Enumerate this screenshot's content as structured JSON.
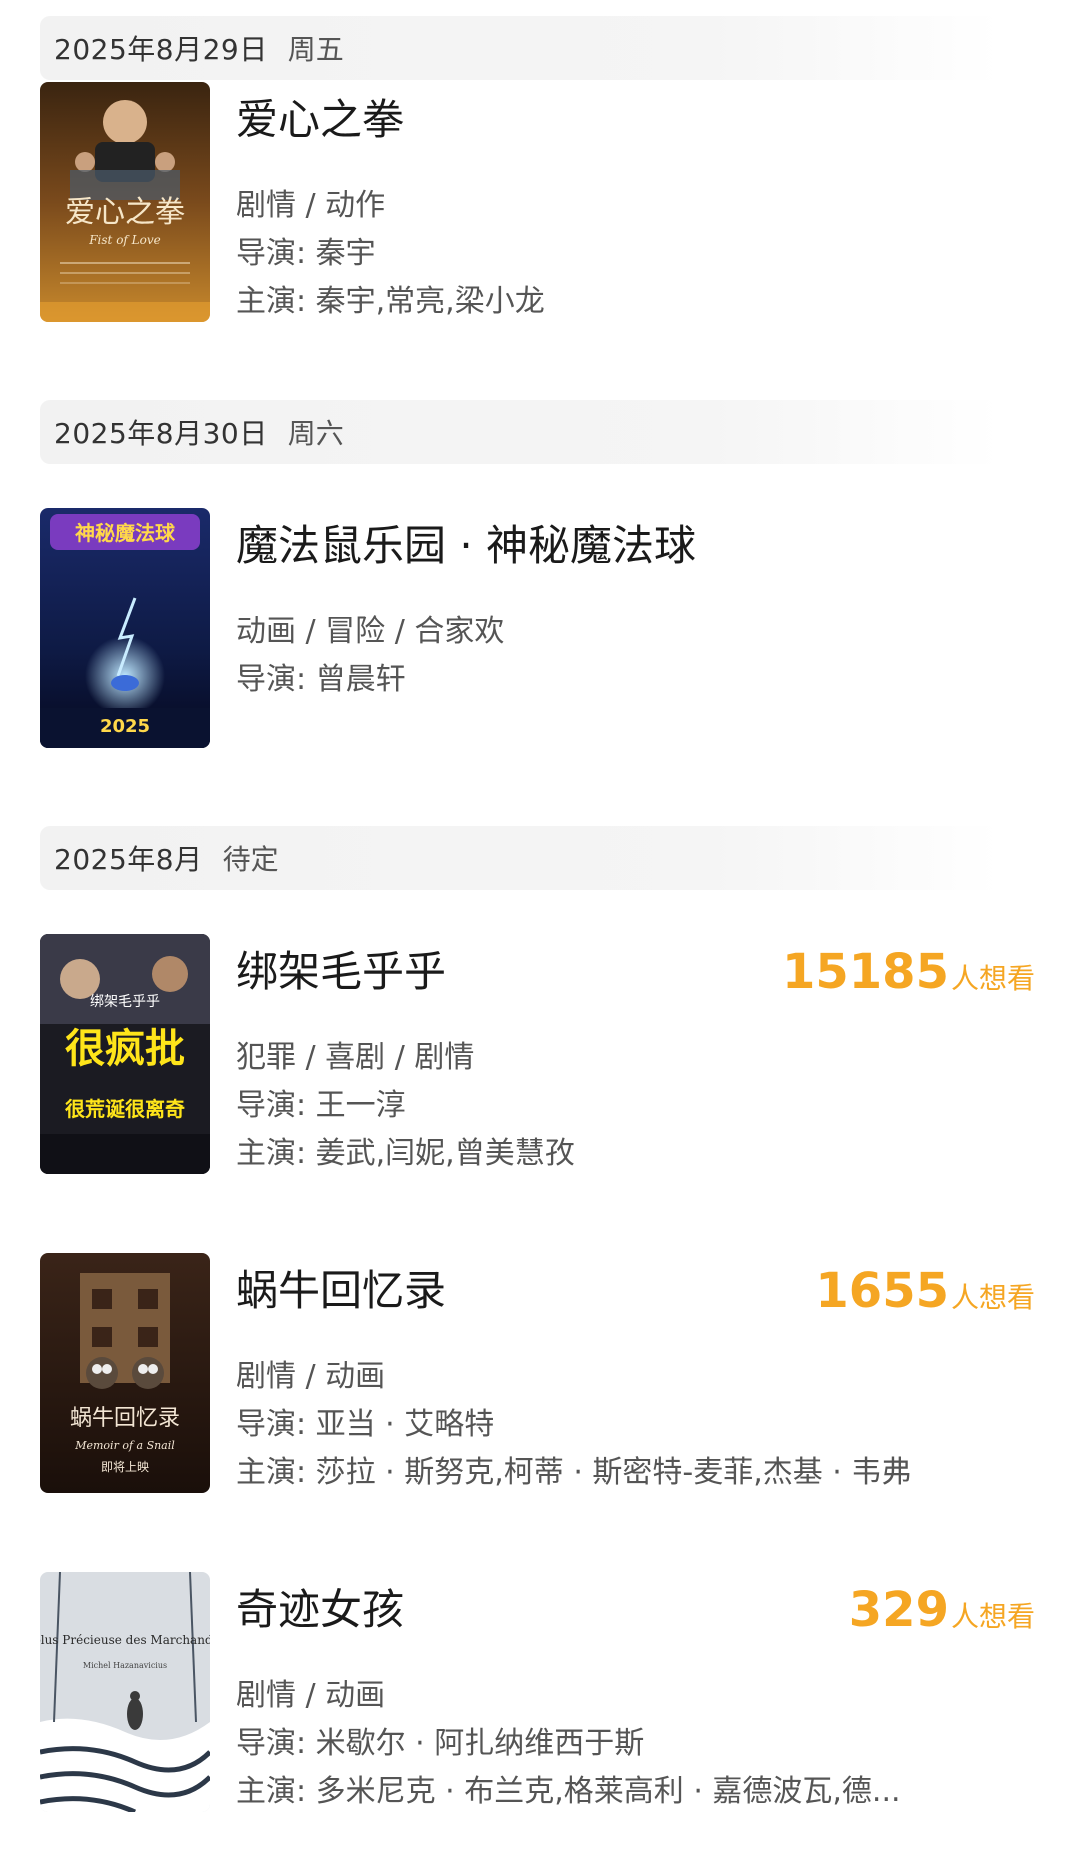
{
  "sections": [
    {
      "date": "2025年8月29日",
      "weekday": "周五",
      "movies": [
        {
          "title": "爱心之拳",
          "genre": "剧情 / 动作",
          "director": "导演: 秦宇",
          "cast": "主演: 秦宇,常亮,梁小龙",
          "poster_text": "爱心之拳",
          "poster_subtext": "Fist of Love"
        }
      ]
    },
    {
      "date": "2025年8月30日",
      "weekday": "周六",
      "movies": [
        {
          "title": "魔法鼠乐园 · 神秘魔法球",
          "genre": "动画 / 冒险 / 合家欢",
          "director": "导演: 曾晨轩",
          "poster_text": "神秘魔法球",
          "poster_subtext": "2025"
        }
      ]
    },
    {
      "date": "2025年8月",
      "weekday": "待定",
      "movies": [
        {
          "title": "绑架毛乎乎",
          "genre": "犯罪 / 喜剧 / 剧情",
          "director": "导演: 王一淳",
          "cast": "主演: 姜武,闫妮,曾美慧孜",
          "want_count": "15185",
          "want_unit": "人想看",
          "poster_text": "很疯批",
          "poster_subtext": "很荒诞很离奇",
          "poster_small": "绑架毛乎乎"
        },
        {
          "title": "蜗牛回忆录",
          "genre": "剧情 / 动画",
          "director": "导演: 亚当 · 艾略特",
          "cast": "主演: 莎拉 · 斯努克,柯蒂 · 斯密特-麦菲,杰基 · 韦弗",
          "want_count": "1655",
          "want_unit": "人想看",
          "poster_text": "蜗牛回忆录",
          "poster_subtext": "Memoir of a Snail",
          "poster_small": "即将上映"
        },
        {
          "title": "奇迹女孩",
          "genre": "剧情 / 动画",
          "director": "导演: 米歇尔 · 阿扎纳维西于斯",
          "cast": "主演: 多米尼克 · 布兰克,格莱高利 · 嘉德波瓦,德...",
          "want_count": "329",
          "want_unit": "人想看",
          "poster_text": "La plus Précieuse des Marchandises",
          "poster_subtext": "Michel Hazanavicius"
        }
      ]
    }
  ],
  "colors": {
    "want_accent": "#f5a623",
    "date_bar_bg": "#f2f2f2"
  }
}
